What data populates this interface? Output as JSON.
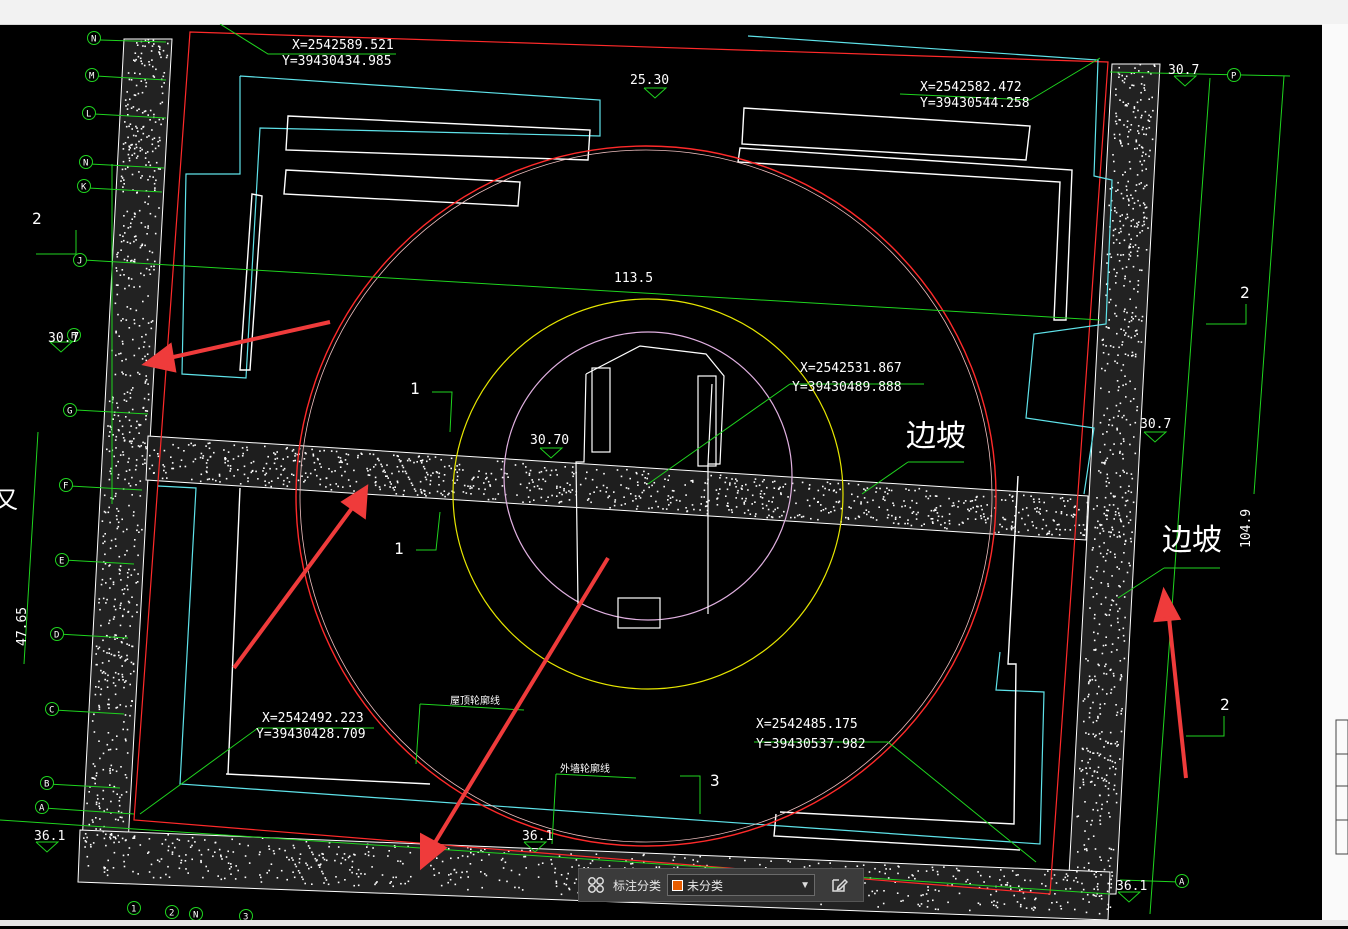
{
  "colors": {
    "background": "#000000",
    "boundary_red": "#ff2a2a",
    "grid_green": "#1fd41f",
    "wall_white": "#ffffff",
    "wall_cyan": "#5fe3ea",
    "circle_yellow": "#e6e600",
    "arrow_red": "#ef3b3b",
    "accent_orange": "#e65c00"
  },
  "coordinates": [
    {
      "x": "X=2542589.521",
      "y": "Y=39430434.985"
    },
    {
      "x": "X=2542582.472",
      "y": "Y=39430544.258"
    },
    {
      "x": "X=2542531.867",
      "y": "Y=39430489.888"
    },
    {
      "x": "X=2542492.223",
      "y": "Y=39430428.709"
    },
    {
      "x": "X=2542485.175",
      "y": "Y=39430537.982"
    }
  ],
  "elevations": [
    "25.30",
    "30.7",
    "30.7",
    "30.70",
    "30.7",
    "36.1",
    "36.1",
    "36.1"
  ],
  "dimensions": [
    "113.5",
    "104.9",
    "47.65"
  ],
  "slope_labels": [
    "边坡",
    "边坡"
  ],
  "section_marks": [
    "1",
    "1",
    "2",
    "2",
    "2",
    "3"
  ],
  "small_notes": [
    "屋顶轮廓线",
    "外墙轮廓线"
  ],
  "grid_axes_left": [
    "N",
    "M",
    "L",
    "N",
    "K",
    "J",
    "H",
    "G",
    "F",
    "E",
    "D",
    "C",
    "B",
    "A"
  ],
  "grid_axes_other": [
    "P",
    "A",
    "1",
    "2",
    "N",
    "3"
  ],
  "left_edge_glyph": "又",
  "toolbar": {
    "grid_icon": "four-squares-icon",
    "label": "标注分类",
    "selected": "未分类",
    "edit_icon": "edit-icon"
  }
}
